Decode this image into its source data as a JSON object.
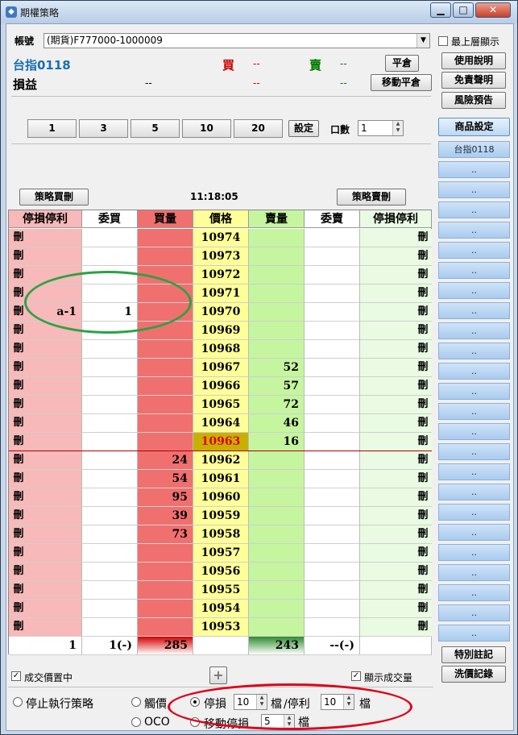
{
  "window": {
    "title": "期權策略",
    "minimize": "▁",
    "maximize": "□",
    "close": "✕",
    "icon": "app-icon"
  },
  "account": {
    "label": "帳號",
    "value": "(期貨)F777000-1000009"
  },
  "topmost": {
    "label": "最上層顯示",
    "checked": false
  },
  "header": {
    "product": "台指0118",
    "pnl_label": "損益",
    "pnl_value": "--",
    "buy_label": "買",
    "buy_value": "--",
    "buy_pnl": "--",
    "sell_label": "賣",
    "sell_value": "--",
    "sell_pnl": "--",
    "flat_btn": "平倉",
    "move_flat_btn": "移動平倉"
  },
  "side_buttons": {
    "help": "使用說明",
    "disclaimer": "免責聲明",
    "risk": "風險預告",
    "product_setting": "商品設定"
  },
  "products": [
    "台指0118",
    "..",
    "..",
    "..",
    "..",
    "..",
    "..",
    "..",
    "..",
    "..",
    "..",
    "..",
    "..",
    "..",
    "..",
    "..",
    "..",
    "..",
    "..",
    "..",
    "..",
    "..",
    "..",
    "..",
    ".."
  ],
  "quantity_buttons": [
    "1",
    "3",
    "5",
    "10",
    "20"
  ],
  "set_btn": "設定",
  "lots": {
    "label": "口數",
    "value": "1"
  },
  "strategy": {
    "buy_cancel": "策略買刪",
    "sell_cancel": "策略賣刪",
    "time": "11:18:05"
  },
  "grid": {
    "headers": [
      "停損停利",
      "委買",
      "買量",
      "價格",
      "賣量",
      "委賣",
      "停損停利"
    ],
    "del_label": "刪",
    "rows": [
      {
        "stop_buy": "",
        "bid": "",
        "bid_vol": "",
        "price": "10974",
        "ask_vol": "",
        "ask": "",
        "stop_sell": ""
      },
      {
        "stop_buy": "",
        "bid": "",
        "bid_vol": "",
        "price": "10973",
        "ask_vol": "",
        "ask": "",
        "stop_sell": ""
      },
      {
        "stop_buy": "",
        "bid": "",
        "bid_vol": "",
        "price": "10972",
        "ask_vol": "",
        "ask": "",
        "stop_sell": ""
      },
      {
        "stop_buy": "",
        "bid": "",
        "bid_vol": "",
        "price": "10971",
        "ask_vol": "",
        "ask": "",
        "stop_sell": ""
      },
      {
        "stop_buy": "a-1",
        "bid": "1",
        "bid_vol": "",
        "price": "10970",
        "ask_vol": "",
        "ask": "",
        "stop_sell": ""
      },
      {
        "stop_buy": "",
        "bid": "",
        "bid_vol": "",
        "price": "10969",
        "ask_vol": "",
        "ask": "",
        "stop_sell": ""
      },
      {
        "stop_buy": "",
        "bid": "",
        "bid_vol": "",
        "price": "10968",
        "ask_vol": "",
        "ask": "",
        "stop_sell": ""
      },
      {
        "stop_buy": "",
        "bid": "",
        "bid_vol": "",
        "price": "10967",
        "ask_vol": "52",
        "ask": "",
        "stop_sell": ""
      },
      {
        "stop_buy": "",
        "bid": "",
        "bid_vol": "",
        "price": "10966",
        "ask_vol": "57",
        "ask": "",
        "stop_sell": ""
      },
      {
        "stop_buy": "",
        "bid": "",
        "bid_vol": "",
        "price": "10965",
        "ask_vol": "72",
        "ask": "",
        "stop_sell": ""
      },
      {
        "stop_buy": "",
        "bid": "",
        "bid_vol": "",
        "price": "10964",
        "ask_vol": "46",
        "ask": "",
        "stop_sell": ""
      },
      {
        "stop_buy": "",
        "bid": "",
        "bid_vol": "",
        "price": "10963",
        "ask_vol": "16",
        "ask": "",
        "stop_sell": "",
        "last": true
      },
      {
        "stop_buy": "",
        "bid": "",
        "bid_vol": "24",
        "price": "10962",
        "ask_vol": "",
        "ask": "",
        "stop_sell": ""
      },
      {
        "stop_buy": "",
        "bid": "",
        "bid_vol": "54",
        "price": "10961",
        "ask_vol": "",
        "ask": "",
        "stop_sell": ""
      },
      {
        "stop_buy": "",
        "bid": "",
        "bid_vol": "95",
        "price": "10960",
        "ask_vol": "",
        "ask": "",
        "stop_sell": ""
      },
      {
        "stop_buy": "",
        "bid": "",
        "bid_vol": "39",
        "price": "10959",
        "ask_vol": "",
        "ask": "",
        "stop_sell": ""
      },
      {
        "stop_buy": "",
        "bid": "",
        "bid_vol": "73",
        "price": "10958",
        "ask_vol": "",
        "ask": "",
        "stop_sell": ""
      },
      {
        "stop_buy": "",
        "bid": "",
        "bid_vol": "",
        "price": "10957",
        "ask_vol": "",
        "ask": "",
        "stop_sell": ""
      },
      {
        "stop_buy": "",
        "bid": "",
        "bid_vol": "",
        "price": "10956",
        "ask_vol": "",
        "ask": "",
        "stop_sell": ""
      },
      {
        "stop_buy": "",
        "bid": "",
        "bid_vol": "",
        "price": "10955",
        "ask_vol": "",
        "ask": "",
        "stop_sell": ""
      },
      {
        "stop_buy": "",
        "bid": "",
        "bid_vol": "",
        "price": "10954",
        "ask_vol": "",
        "ask": "",
        "stop_sell": ""
      },
      {
        "stop_buy": "",
        "bid": "",
        "bid_vol": "",
        "price": "10953",
        "ask_vol": "",
        "ask": "",
        "stop_sell": ""
      }
    ],
    "totals": {
      "stop_buy": "1",
      "bid": "1(-)",
      "bid_vol": "285",
      "price": "",
      "ask_vol": "243",
      "ask": "--(-)",
      "stop_sell": ""
    }
  },
  "footer": {
    "center_price": {
      "label": "成交價置中",
      "checked": true
    },
    "show_volume": {
      "label": "顯示成交量",
      "checked": true
    },
    "plus": "+",
    "special_btn": "特別註記",
    "wash_btn": "洗價記錄",
    "stop_strategy": "停止執行策略",
    "trigger": "觸價",
    "oco": "OCO",
    "stop_loss": {
      "label": "停損",
      "value": "10",
      "unit": "檔"
    },
    "take_profit": {
      "label": "/停利",
      "value": "10",
      "unit": "檔"
    },
    "trailing": {
      "label": "移動停損",
      "value": "5",
      "unit": "檔"
    }
  },
  "colors": {
    "buy": "#cc0000",
    "sell": "#007a00",
    "product": "#1a6fb0",
    "stop_bg": "#f7b9b9",
    "bid_vol_bg": "#f07070",
    "price_bg": "#ffff99",
    "ask_vol_bg": "#c6f5a0",
    "stop_sell_bg": "#e9fbe3",
    "annotation": "#2aa345",
    "highlight": "#e0001a"
  }
}
